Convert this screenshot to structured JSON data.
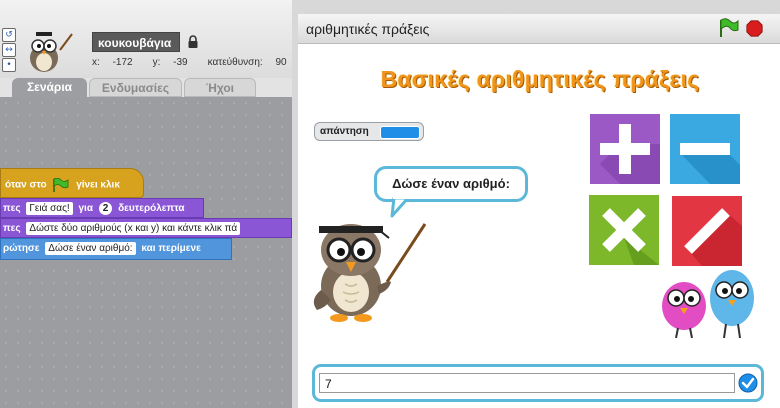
{
  "sprite": {
    "name": "κουκουβάγια",
    "x_label": "x:",
    "x_value": "-172",
    "y_label": "y:",
    "y_value": "-39",
    "direction_label": "κατεύθυνση:",
    "direction_value": "90"
  },
  "tabs": {
    "scripts": "Σενάρια",
    "costumes": "Ενδυμασίες",
    "sounds": "Ήχοι"
  },
  "blocks": {
    "hat_start": "όταν στο",
    "hat_end": "γίνει κλικ",
    "say1_verb": "πες",
    "say1_text": "Γειά σας!",
    "say1_for": "για",
    "say1_secs": "2",
    "say1_unit": "δευτερόλεπτα",
    "say2_verb": "πες",
    "say2_text": "Δώστε δύο αριθμούς (x και y) και κάντε κλικ πά",
    "ask_verb": "ρώτησε",
    "ask_text": "Δώσε έναν αριθμό:",
    "ask_wait": "και περίμενε"
  },
  "stage": {
    "title": "αριθμητικές πράξεις",
    "heading": "Βασικές αριθμητικές πράξεις",
    "answer_label": "απάντηση",
    "speech": "Δώσε έναν αριθμό:",
    "input_value": "7"
  },
  "colors": {
    "plus": "#9a59c4",
    "minus": "#3aa9e1",
    "times": "#7cb82a",
    "divide": "#e23642",
    "event_block": "#d7a21e",
    "looks_block": "#8a56d6",
    "sensing_block": "#5195dc"
  },
  "icons": {
    "flag": "green-flag-icon",
    "stop": "stop-icon",
    "lock": "lock-icon",
    "submit": "check-icon"
  }
}
